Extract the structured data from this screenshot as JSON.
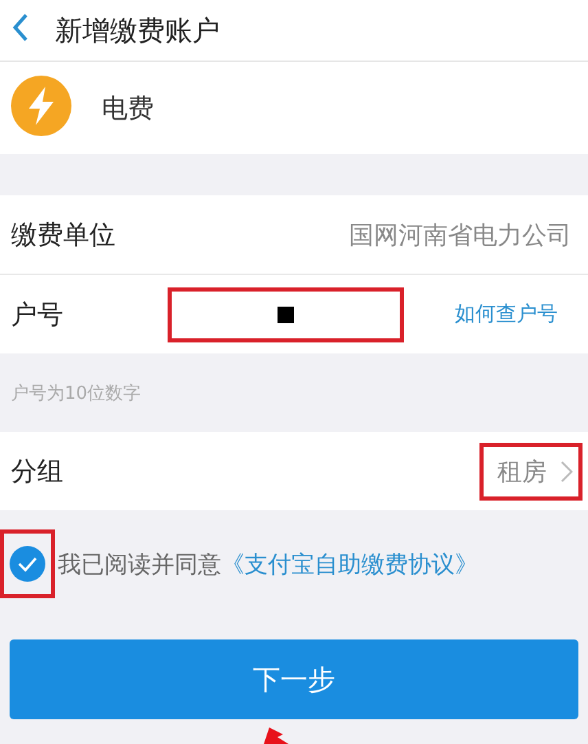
{
  "header": {
    "title": "新增缴费账户"
  },
  "service": {
    "name": "电费"
  },
  "form": [
    {
      "kind": "value",
      "label": "缴费单位",
      "value": "国网河南省电力公司"
    },
    {
      "kind": "input",
      "label": "户号",
      "redacted": true,
      "highlighted": true,
      "link": "如何查户号"
    }
  ],
  "hint": "户号为10位数字",
  "group": {
    "label": "分组",
    "value": "租房",
    "highlighted": true
  },
  "agreement": {
    "checked": true,
    "highlighted": true,
    "text": "我已阅读并同意",
    "link": "《支付宝自助缴费协议》"
  },
  "button": {
    "label": "下一步"
  },
  "pointer_arrow": true
}
